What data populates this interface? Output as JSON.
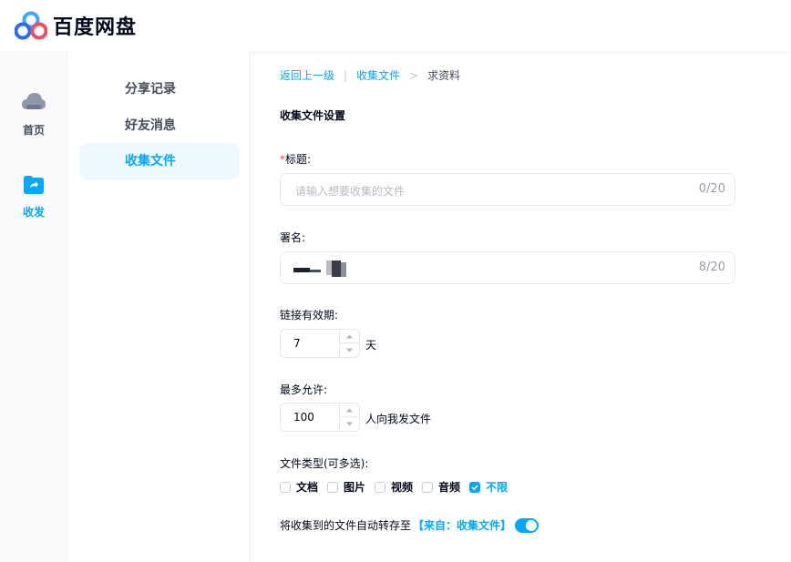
{
  "app": {
    "title": "百度网盘",
    "logo_icon": "baidu-netdisk-logo-icon"
  },
  "rail": {
    "items": [
      {
        "label": "首页",
        "icon": "cloud-icon",
        "active": false
      },
      {
        "label": "收发",
        "icon": "share-folder-icon",
        "active": true
      }
    ]
  },
  "subnav": {
    "items": [
      {
        "label": "分享记录",
        "active": false
      },
      {
        "label": "好友消息",
        "active": false
      },
      {
        "label": "收集文件",
        "active": true
      }
    ]
  },
  "breadcrumb": {
    "back": "返回上一级",
    "divider": "|",
    "parent": "收集文件",
    "arrow": ">",
    "current": "求资料"
  },
  "form": {
    "section_title": "收集文件设置",
    "title_field": {
      "required_mark": "*",
      "label": "标题:",
      "placeholder": "请输入想要收集的文件",
      "count": "0/20"
    },
    "signature_field": {
      "label": "署名:",
      "count": "8/20"
    },
    "validity": {
      "label": "链接有效期:",
      "value": "7",
      "unit": "天"
    },
    "max_allowed": {
      "label": "最多允许:",
      "value": "100",
      "unit": "人向我发文件"
    },
    "file_types": {
      "label": "文件类型(可多选):",
      "options": [
        {
          "label": "文档",
          "checked": false
        },
        {
          "label": "图片",
          "checked": false
        },
        {
          "label": "视频",
          "checked": false
        },
        {
          "label": "音频",
          "checked": false
        },
        {
          "label": "不限",
          "checked": true
        }
      ]
    },
    "auto_save": {
      "label": "将收集到的文件自动转存至",
      "target": "【来自：收集文件】",
      "enabled": true
    }
  },
  "colors": {
    "accent": "#06a7ff",
    "required": "#f33f3f",
    "text": "#03081a"
  }
}
